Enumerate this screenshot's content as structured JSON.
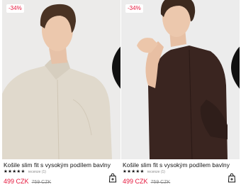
{
  "products": [
    {
      "badge": "-34%",
      "title": "Košile slim fit s vysokým podílem bavlny",
      "stars": "★★★★★",
      "reviews": "recenze (1)",
      "price": "499 CZK",
      "old_price": "759 CZK",
      "icons": {
        "wishlist": "heart-icon",
        "cart": "add-to-bag-icon"
      }
    },
    {
      "badge": "-34%",
      "title": "Košile slim fit s vysokým podílem bavlny",
      "stars": "★★★★★",
      "reviews": "recenze (1)",
      "price": "499 CZK",
      "old_price": "759 CZK",
      "icons": {
        "wishlist": "heart-icon",
        "cart": "add-to-bag-icon"
      }
    }
  ],
  "colors": {
    "sale": "#e5163c",
    "muted": "#8a8a8a",
    "text": "#111111"
  }
}
